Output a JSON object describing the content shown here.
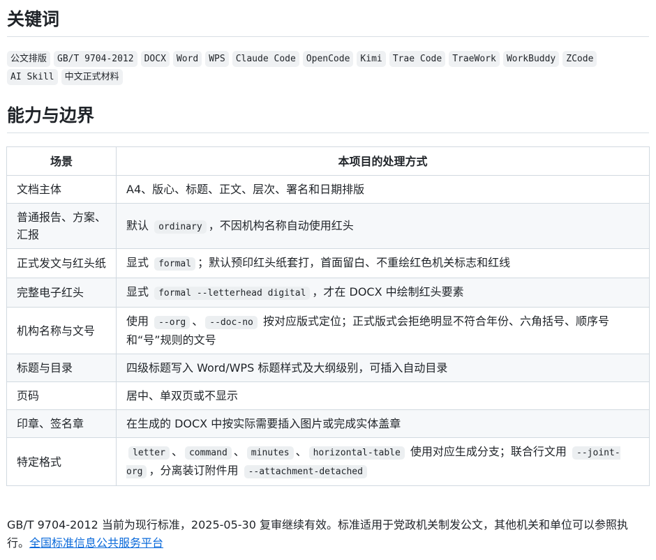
{
  "sections": {
    "keywords_title": "关键词",
    "capability_title": "能力与边界"
  },
  "keywords": [
    "公文排版",
    "GB/T 9704-2012",
    "DOCX",
    "Word",
    "WPS",
    "Claude Code",
    "OpenCode",
    "Kimi",
    "Trae Code",
    "TraeWork",
    "WorkBuddy",
    "ZCode",
    "AI Skill",
    "中文正式材料"
  ],
  "table": {
    "headers": [
      "场景",
      "本项目的处理方式"
    ],
    "rows": [
      {
        "scene": "文档主体",
        "parts": [
          {
            "t": "A4、版心、标题、正文、层次、署名和日期排版"
          }
        ]
      },
      {
        "scene": "普通报告、方案、汇报",
        "parts": [
          {
            "t": "默认 "
          },
          {
            "c": "ordinary"
          },
          {
            "t": "，不因机构名称自动使用红头"
          }
        ]
      },
      {
        "scene": "正式发文与红头纸",
        "parts": [
          {
            "t": "显式 "
          },
          {
            "c": "formal"
          },
          {
            "t": "；默认预印红头纸套打，首面留白、不重绘红色机关标志和红线"
          }
        ]
      },
      {
        "scene": "完整电子红头",
        "parts": [
          {
            "t": "显式 "
          },
          {
            "c": "formal --letterhead digital"
          },
          {
            "t": "，才在 DOCX 中绘制红头要素"
          }
        ]
      },
      {
        "scene": "机构名称与文号",
        "parts": [
          {
            "t": "使用 "
          },
          {
            "c": "--org"
          },
          {
            "t": "、"
          },
          {
            "c": "--doc-no"
          },
          {
            "t": " 按对应版式定位；正式版式会拒绝明显不符合年份、六角括号、顺序号和“号”规则的文号"
          }
        ]
      },
      {
        "scene": "标题与目录",
        "parts": [
          {
            "t": "四级标题写入 Word/WPS 标题样式及大纲级别，可插入自动目录"
          }
        ]
      },
      {
        "scene": "页码",
        "parts": [
          {
            "t": "居中、单双页或不显示"
          }
        ]
      },
      {
        "scene": "印章、签名章",
        "parts": [
          {
            "t": "在生成的 DOCX 中按实际需要插入图片或完成实体盖章"
          }
        ]
      },
      {
        "scene": "特定格式",
        "parts": [
          {
            "c": "letter"
          },
          {
            "t": "、"
          },
          {
            "c": "command"
          },
          {
            "t": "、"
          },
          {
            "c": "minutes"
          },
          {
            "t": "、"
          },
          {
            "c": "horizontal-table"
          },
          {
            "t": " 使用对应生成分支；联合行文用 "
          },
          {
            "c": "--joint-org"
          },
          {
            "t": "，分离装订附件用 "
          },
          {
            "c": "--attachment-detached"
          }
        ]
      }
    ]
  },
  "footer": {
    "text": "GB/T 9704-2012 当前为现行标准，2025-05-30 复审继续有效。标准适用于党政机关制发公文，其他机关和单位可以参照执行。",
    "link_text": "全国标准信息公共服务平台"
  }
}
